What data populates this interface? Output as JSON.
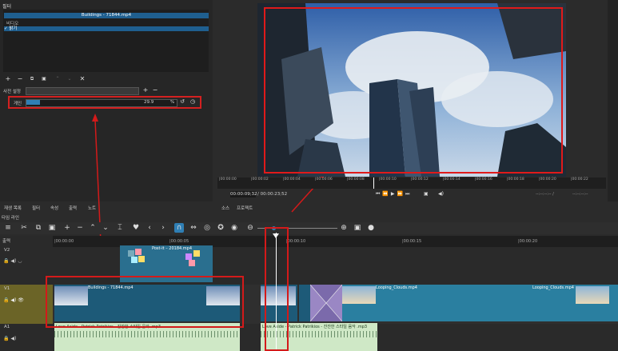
{
  "filter_panel": {
    "title": "필터",
    "clip_name": "Buildings - 71844.mp4",
    "group": "비디오",
    "filter_item": "✓ 밝기",
    "preset_label": "사전 설정",
    "gain_label": "게인",
    "gain_value": "29.9",
    "gain_unit": "%",
    "gain_fraction": 0.09
  },
  "viewer": {
    "current_time": "00:00:09;32",
    "total_time": "/ 00:00:23;52",
    "tabs": [
      "소스",
      "프로젝트"
    ],
    "ruler_ticks": [
      "|00:00:00",
      "|00:00:02",
      "|00:00:04",
      "|00:00:06",
      "|00:00:08",
      "|00:00:10",
      "|00:00:12",
      "|00:00:14",
      "|00:00:16",
      "|00:00:18",
      "|00:00:20",
      "|00:00:22"
    ],
    "in_out": "--:--:--:-- /",
    "out": "--:--:--:--"
  },
  "left_tabs": [
    "재생 목록",
    "필터",
    "속성",
    "출력",
    "노트"
  ],
  "timeline": {
    "title": "타임 라인",
    "header_label": "출력",
    "ruler_ticks": [
      "|00:00:00",
      "|00:00:05",
      "|00:00:10",
      "|00:00:15",
      "|00:00:20"
    ],
    "tracks": [
      "V2",
      "V1",
      "A1"
    ],
    "clips": {
      "v2_clip": "Post-it – 20184.mp4",
      "v1_clip1": "Buildings - 71844.mp4",
      "v1_clip3": "Looping_Clouds.mp4",
      "v1_clip4": "Looping_Clouds.mp4",
      "a1_clip1": "Love Aside - Patrick Patrikios - 잔잔한 스타일 음악 .mp3",
      "a1_clip2": "Love Aside - Patrick Patrikios - 잔잔한 스타일 음악 .mp3"
    }
  },
  "colors": {
    "accent": "#1f5f8f",
    "annotation": "#d41a1a",
    "video_clip": "#2a6f8f",
    "audio_clip": "#cfe8c6",
    "selected_track": "#6b6427"
  }
}
